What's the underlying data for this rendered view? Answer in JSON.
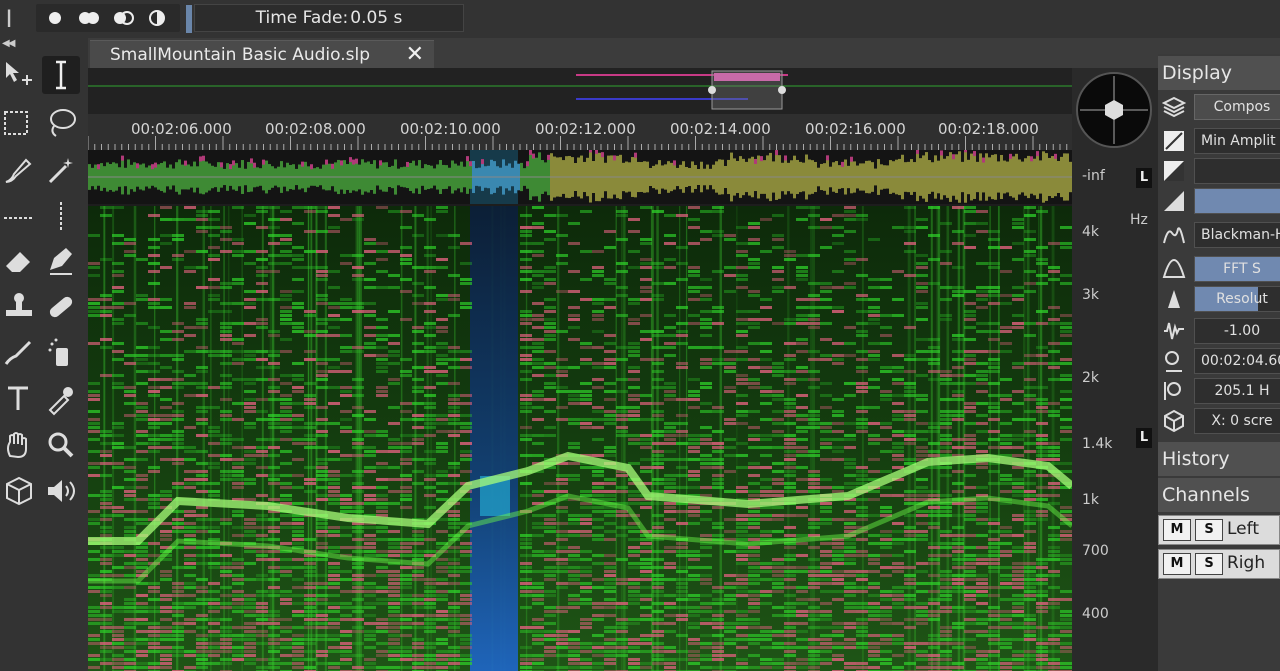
{
  "toolbar": {
    "selection_modes": [
      "full-circle-icon",
      "double-circle-icon",
      "half-circle-icon",
      "split-circle-icon"
    ],
    "time_fade_label": "Time Fade:",
    "time_fade_value": "0.05 s"
  },
  "document_tab": {
    "title": "SmallMountain Basic Audio.slp",
    "close_label": "✕"
  },
  "timeline": {
    "ticks": [
      "00:02:06.000",
      "00:02:08.000",
      "00:02:10.000",
      "00:02:12.000",
      "00:02:14.000",
      "00:02:16.000",
      "00:02:18.000"
    ]
  },
  "scale": {
    "waveform_label": "-inf",
    "unit": "Hz",
    "freq_labels": [
      "4k",
      "3k",
      "2k",
      "1.4k",
      "1k",
      "700",
      "400"
    ],
    "channel_badge": "L"
  },
  "panel": {
    "display_title": "Display",
    "rows": {
      "composite": "Compos",
      "min_amplitude": "Min Amplit",
      "window": "Blackman-H",
      "fft_size": "FFT S",
      "resolution": "Resolut",
      "reassign": "-1.00",
      "time_position": "00:02:04.60",
      "frequency": "205.1  H",
      "pan": "X: 0  scre"
    },
    "history_title": "History",
    "channels_title": "Channels",
    "channels": [
      {
        "mute": "M",
        "solo": "S",
        "name": "Left"
      },
      {
        "mute": "M",
        "solo": "S",
        "name": "Righ"
      }
    ]
  },
  "colors": {
    "accent": "#7089b0",
    "spectrogram_green": "#2fd42a",
    "spectrogram_pink": "#d9607a",
    "spectrogram_blue": "#2a6fd8"
  }
}
